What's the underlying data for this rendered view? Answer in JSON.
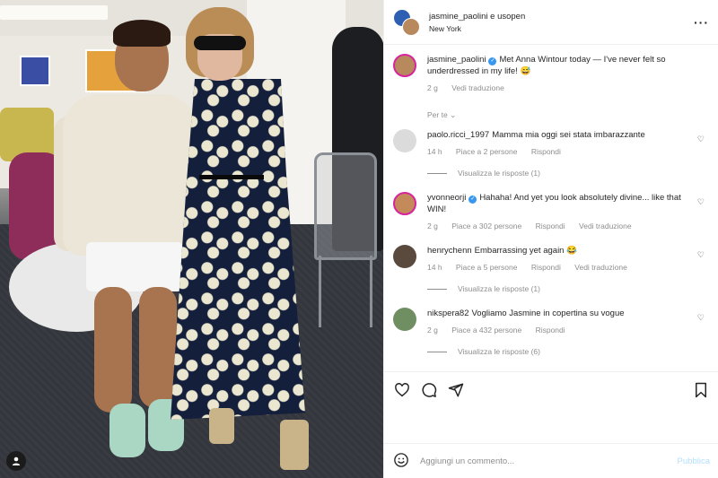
{
  "post": {
    "author": "jasmine_paolini",
    "collab_join": "e",
    "collaborator": "usopen",
    "location": "New York",
    "options_icon": "more-horizontal-icon"
  },
  "caption": {
    "username": "jasmine_paolini",
    "verified": true,
    "text": "Met Anna Wintour today — I've never felt so underdressed in my life! 😅",
    "time": "2 g",
    "translate": "Vedi traduzione"
  },
  "for_you_label": "Per te",
  "comments": [
    {
      "username": "paolo.ricci_1997",
      "verified": false,
      "text": "Mamma mia oggi sei stata imbarazzante",
      "time": "14 h",
      "likes": "Piace a 2 persone",
      "reply": "Rispondi",
      "translate": "",
      "replies_label": "Visualizza le risposte (1)",
      "avatar_color": "#dbdbdb"
    },
    {
      "username": "yvonneorji",
      "verified": true,
      "text": "Hahaha! And yet you look absolutely divine... like that WIN!",
      "time": "2 g",
      "likes": "Piace a 302 persone",
      "reply": "Rispondi",
      "translate": "Vedi traduzione",
      "replies_label": "",
      "avatar_color": "#c48a5a"
    },
    {
      "username": "henrychenn",
      "verified": false,
      "text": "Embarrassing yet again 😂",
      "time": "14 h",
      "likes": "Piace a 5 persone",
      "reply": "Rispondi",
      "translate": "Vedi traduzione",
      "replies_label": "Visualizza le risposte (1)",
      "avatar_color": "#5a4a3e"
    },
    {
      "username": "nikspera82",
      "verified": false,
      "text": "Vogliamo Jasmine in copertina su vogue",
      "time": "2 g",
      "likes": "Piace a 432 persone",
      "reply": "Rispondi",
      "translate": "",
      "replies_label": "Visualizza le risposte (6)",
      "avatar_color": "#6f8f62"
    }
  ],
  "actions": {
    "like_icon": "heart-icon",
    "comment_icon": "comment-icon",
    "share_icon": "send-icon",
    "save_icon": "bookmark-icon"
  },
  "composer": {
    "placeholder": "Aggiungi un commento...",
    "publish": "Pubblica",
    "emoji_icon": "emoji-icon"
  },
  "colors": {
    "accent": "#0095f6",
    "verified": "#3897f0",
    "muted": "#8e8e8e"
  }
}
